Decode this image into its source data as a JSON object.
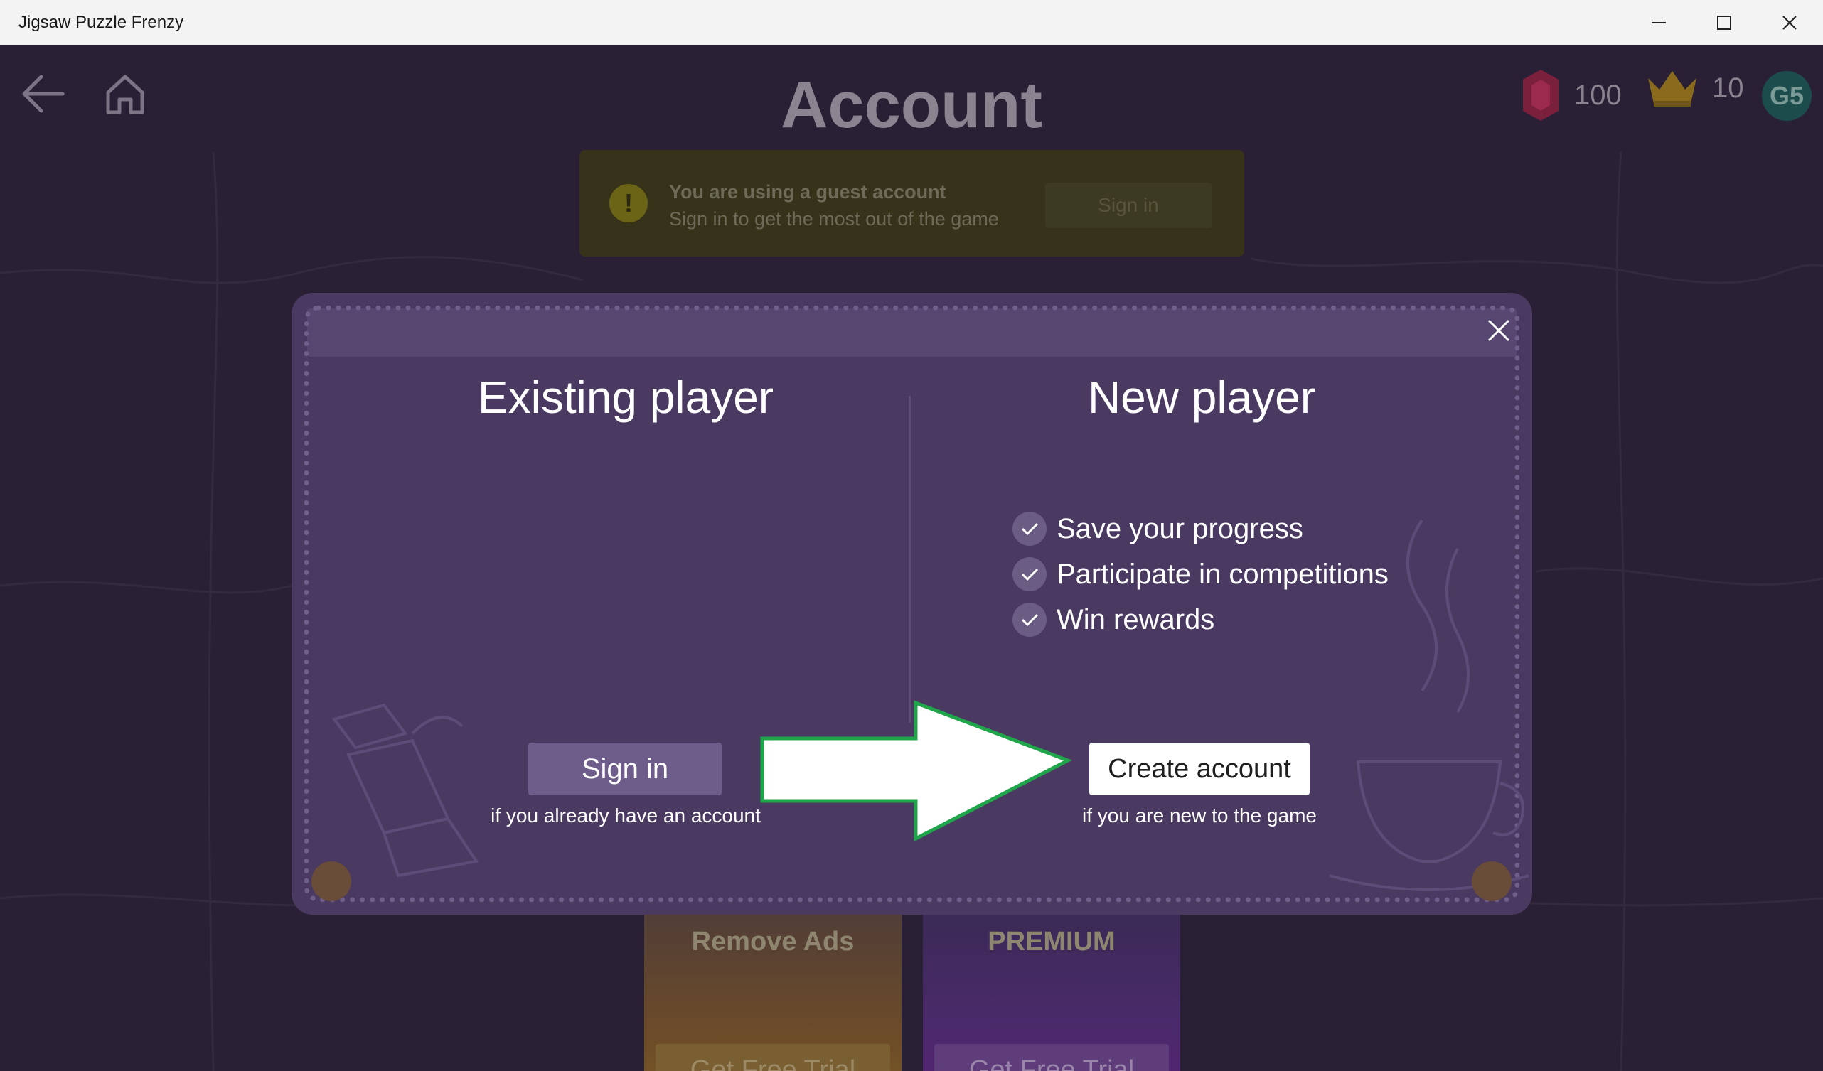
{
  "window": {
    "title": "Jigsaw Puzzle Frenzy"
  },
  "header": {
    "title": "Account",
    "gems": "100",
    "crowns": "10",
    "avatar": "G5"
  },
  "guest_banner": {
    "title": "You are using a guest account",
    "subtitle": "Sign in to get the most out of the game",
    "signin_label": "Sign in"
  },
  "cards": [
    {
      "title": "Remove Ads",
      "button": "Get Free Trial"
    },
    {
      "title": "PREMIUM",
      "button": "Get Free Trial"
    }
  ],
  "dialog": {
    "existing": {
      "title": "Existing player",
      "button": "Sign in",
      "hint": "if you already have an account"
    },
    "new": {
      "title": "New player",
      "benefits": [
        "Save your progress",
        "Participate in competitions",
        "Win rewards"
      ],
      "button": "Create account",
      "hint": "if you are new to the game"
    }
  },
  "colors": {
    "background": "#2a2035",
    "dialog": "#4a3a62",
    "arrow_outline": "#1fa64a"
  }
}
